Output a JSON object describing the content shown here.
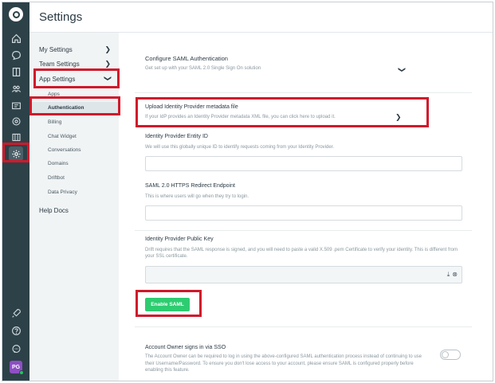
{
  "header": {
    "title": "Settings"
  },
  "nav": {
    "my_settings": "My Settings",
    "team_settings": "Team Settings",
    "app_settings": "App Settings",
    "app_sub": [
      "Apps",
      "Authentication",
      "Billing",
      "Chat Widget",
      "Conversations",
      "Domains",
      "Driftbot",
      "Data Privacy"
    ],
    "help_docs": "Help Docs"
  },
  "saml": {
    "title": "Configure SAML Authentication",
    "subtitle": "Get set up with your SAML 2.0 Single Sign On solution"
  },
  "upload": {
    "title": "Upload Identity Provider metadata file",
    "desc": "If your IdP provides an Identity Provider metadata XML file, you can click here to upload it."
  },
  "entity_id": {
    "label": "Identity Provider Entity ID",
    "desc": "We will use this globally unique ID to identify requests coming from your Identity Provider.",
    "value": ""
  },
  "endpoint": {
    "label": "SAML 2.0 HTTPS Redirect Endpoint",
    "desc": "This is where users will go when they try to login.",
    "value": ""
  },
  "public_key": {
    "label": "Identity Provider Public Key",
    "desc": "Drift requires that the SAML response is signed, and you will need to paste a valid X.509 .pem Certificate to verify your identity. This is different from your SSL certificate.",
    "value": ""
  },
  "enable_button": "Enable SAML",
  "owner_sso": {
    "title": "Account Owner signs in via SSO",
    "desc": "The Account Owner can be required to log in using the above-configured SAML authentication process instead of continuing to use their Username/Password. To ensure you don't lose access to your account, please ensure SAML is configured properly before enabling this feature.",
    "enabled": false
  },
  "avatar_initials": "PG",
  "rail_icons": [
    "home-icon",
    "chat-icon",
    "book-icon",
    "people-icon",
    "id-card-icon",
    "target-icon",
    "library-icon",
    "gear-icon",
    "rocket-icon",
    "help-icon",
    "feedback-icon"
  ],
  "colors": {
    "highlight": "#d0192b",
    "enable_button": "#2ecc71",
    "rail": "#2d4148"
  }
}
